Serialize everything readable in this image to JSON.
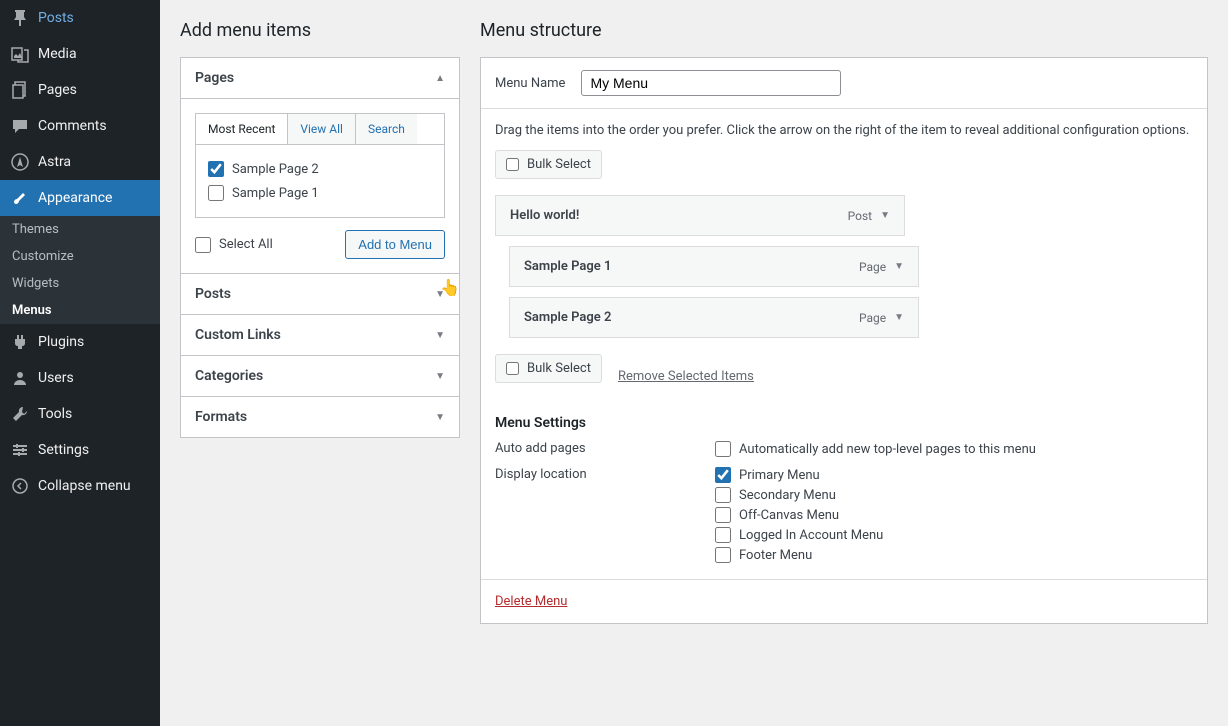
{
  "sidebar": {
    "items": [
      {
        "label": "Posts",
        "icon": "pin"
      },
      {
        "label": "Media",
        "icon": "media"
      },
      {
        "label": "Pages",
        "icon": "pages"
      },
      {
        "label": "Comments",
        "icon": "comments"
      },
      {
        "label": "Astra",
        "icon": "astra"
      },
      {
        "label": "Appearance",
        "icon": "brush",
        "current": true
      },
      {
        "label": "Plugins",
        "icon": "plugin"
      },
      {
        "label": "Users",
        "icon": "users"
      },
      {
        "label": "Tools",
        "icon": "tools"
      },
      {
        "label": "Settings",
        "icon": "settings"
      },
      {
        "label": "Collapse menu",
        "icon": "collapse"
      }
    ],
    "submenu": [
      {
        "label": "Themes"
      },
      {
        "label": "Customize"
      },
      {
        "label": "Widgets"
      },
      {
        "label": "Menus",
        "current": true
      }
    ]
  },
  "left": {
    "heading": "Add menu items",
    "panels": {
      "pages": "Pages",
      "posts": "Posts",
      "custom_links": "Custom Links",
      "categories": "Categories",
      "formats": "Formats"
    },
    "tabs": {
      "recent": "Most Recent",
      "all": "View All",
      "search": "Search"
    },
    "items": [
      {
        "label": "Sample Page 2",
        "checked": true
      },
      {
        "label": "Sample Page 1",
        "checked": false
      }
    ],
    "select_all": "Select All",
    "add_btn": "Add to Menu"
  },
  "right": {
    "heading": "Menu structure",
    "name_label": "Menu Name",
    "name_value": "My Menu",
    "hint": "Drag the items into the order you prefer. Click the arrow on the right of the item to reveal additional configuration options.",
    "bulk_select": "Bulk Select",
    "items": [
      {
        "title": "Hello world!",
        "type": "Post",
        "sub": false
      },
      {
        "title": "Sample Page 1",
        "type": "Page",
        "sub": true
      },
      {
        "title": "Sample Page 2",
        "type": "Page",
        "sub": true
      }
    ],
    "remove_selected": "Remove Selected Items",
    "settings_heading": "Menu Settings",
    "auto_add_label": "Auto add pages",
    "auto_add_option": "Automatically add new top-level pages to this menu",
    "display_loc_label": "Display location",
    "locations": [
      {
        "label": "Primary Menu",
        "checked": true
      },
      {
        "label": "Secondary Menu",
        "checked": false
      },
      {
        "label": "Off-Canvas Menu",
        "checked": false
      },
      {
        "label": "Logged In Account Menu",
        "checked": false
      },
      {
        "label": "Footer Menu",
        "checked": false
      }
    ],
    "delete_menu": "Delete Menu"
  }
}
